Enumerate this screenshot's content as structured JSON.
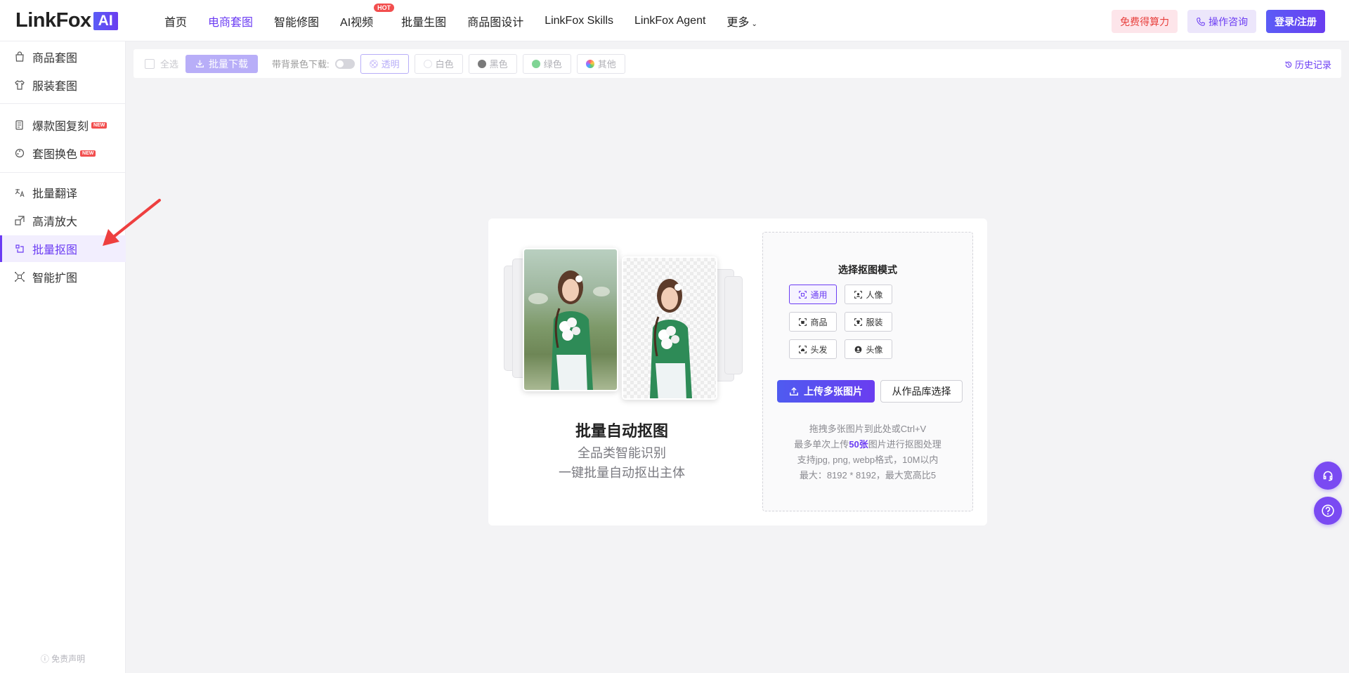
{
  "header": {
    "logo_text": "LinkFox",
    "logo_badge": "AI",
    "nav": [
      {
        "label": "首页",
        "active": false
      },
      {
        "label": "电商套图",
        "active": true
      },
      {
        "label": "智能修图",
        "active": false
      },
      {
        "label": "AI视频",
        "active": false,
        "badge": "HOT"
      },
      {
        "label": "批量生图",
        "active": false
      },
      {
        "label": "商品图设计",
        "active": false
      },
      {
        "label": "LinkFox Skills",
        "active": false
      },
      {
        "label": "LinkFox Agent",
        "active": false
      },
      {
        "label": "更多",
        "active": false
      }
    ],
    "free_credits": "免费得算力",
    "consult": "操作咨询",
    "login": "登录/注册"
  },
  "sidebar": {
    "items": [
      {
        "label": "商品套图",
        "icon": "bag-icon"
      },
      {
        "label": "服装套图",
        "icon": "shirt-icon"
      },
      {
        "label": "爆款图复刻",
        "icon": "copy-icon",
        "badge": "NEW"
      },
      {
        "label": "套图换色",
        "icon": "palette-icon",
        "badge": "NEW"
      },
      {
        "label": "批量翻译",
        "icon": "translate-icon"
      },
      {
        "label": "高清放大",
        "icon": "enlarge-icon"
      },
      {
        "label": "批量抠图",
        "icon": "cutout-icon",
        "active": true
      },
      {
        "label": "智能扩图",
        "icon": "expand-icon"
      }
    ],
    "disclaimer": "免责声明"
  },
  "toolbar": {
    "select_all": "全选",
    "batch_download": "批量下载",
    "bg_download_label": "带背景色下载:",
    "bg_options": [
      {
        "label": "透明",
        "active": true
      },
      {
        "label": "白色",
        "color": "#ffffff"
      },
      {
        "label": "黑色",
        "color": "#7a7a7a"
      },
      {
        "label": "绿色",
        "color": "#7fd494"
      },
      {
        "label": "其他",
        "color": "multi"
      }
    ],
    "history": "历史记录"
  },
  "main": {
    "title": "批量自动抠图",
    "subtitle1": "全品类智能识别",
    "subtitle2": "一键批量自动抠出主体",
    "mode_title": "选择抠图模式",
    "modes": [
      {
        "label": "通用",
        "active": true
      },
      {
        "label": "人像"
      },
      {
        "label": "商品"
      },
      {
        "label": "服装"
      },
      {
        "label": "头发"
      },
      {
        "label": "头像"
      }
    ],
    "upload_button": "上传多张图片",
    "gallery_button": "从作品库选择",
    "hint_line1": "拖拽多张图片到此处或Ctrl+V",
    "hint_line2_pre": "最多单次上传",
    "hint_line2_hl": "50张",
    "hint_line2_post": "图片进行抠图处理",
    "hint_line3": "支持jpg, png, webp格式，10M以内",
    "hint_line4": "最大：8192 * 8192，最大宽高比5"
  },
  "colors": {
    "accent": "#6b3cf3",
    "arrow": "#ee3f3f"
  }
}
